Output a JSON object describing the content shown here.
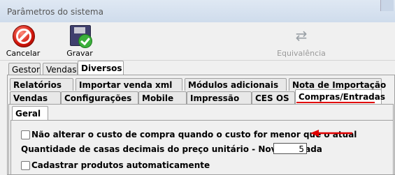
{
  "window": {
    "title": "Parâmetros do sistema"
  },
  "toolbar": {
    "cancel_label": "Cancelar",
    "save_label": "Gravar",
    "equiv_label": "Equivalência"
  },
  "top_tabs": [
    "Gestor",
    "Vendas",
    "Diversos"
  ],
  "tabs_row1": [
    "Relatórios",
    "Importar venda xml",
    "Módulos adicionais",
    "Nota de Importação"
  ],
  "tabs_row2": [
    "Vendas",
    "Configurações",
    "Mobile",
    "Impressão",
    "CES OS",
    "Compras/Entradas"
  ],
  "sub_tabs": [
    "Geral"
  ],
  "options": {
    "dont_change_cost_label": "Não alterar o custo de compra quando o custo for menor que o atual",
    "decimal_places_label": "Quantidade de casas decimais do preço unitário - Nova Entrada",
    "decimal_places_value": "5",
    "auto_register_label": "Cadastrar produtos automaticamente"
  },
  "colors": {
    "annotation_red": "#e00000"
  }
}
